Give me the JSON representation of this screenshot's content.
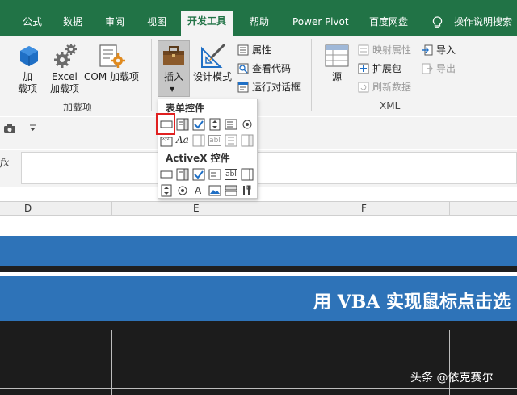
{
  "ribbon_tabs": {
    "formulas": "公式",
    "data": "数据",
    "review": "审阅",
    "view": "视图",
    "developer": "开发工具",
    "help": "帮助",
    "power_pivot": "Power Pivot",
    "baidu_disk": "百度网盘",
    "tell_me": "操作说明搜索"
  },
  "addins_group": {
    "addins_line1": "加",
    "addins_line2": "载项",
    "excel_addins_line1": "Excel",
    "excel_addins_line2": "加载项",
    "com_addins": "COM 加载项",
    "label": "加载项"
  },
  "controls_group": {
    "insert": "插入",
    "design_mode": "设计模式",
    "properties": "属性",
    "view_code": "查看代码",
    "run_dialog": "运行对话框"
  },
  "xml_group": {
    "source": "源",
    "map_properties": "映射属性",
    "expansion_packs": "扩展包",
    "refresh_data": "刷新数据",
    "import": "导入",
    "export": "导出",
    "label": "XML"
  },
  "insert_dropdown": {
    "form_controls": "表单控件",
    "form_text_glyph": "Aa",
    "form_edit_glyph": "abl",
    "activex_controls": "ActiveX 控件",
    "activex_label_glyph": "A",
    "activex_text_glyph": "abl"
  },
  "formula_bar": {
    "fx": "fx"
  },
  "columns": [
    "D",
    "E",
    "F"
  ],
  "sheet": {
    "banner_text": "用 VBA 实现鼠标点击选"
  },
  "watermark": "头条 @依克赛尔",
  "colors": {
    "excel_green": "#217346",
    "banner_blue": "#2e73b8",
    "highlight_red": "#e02020"
  }
}
